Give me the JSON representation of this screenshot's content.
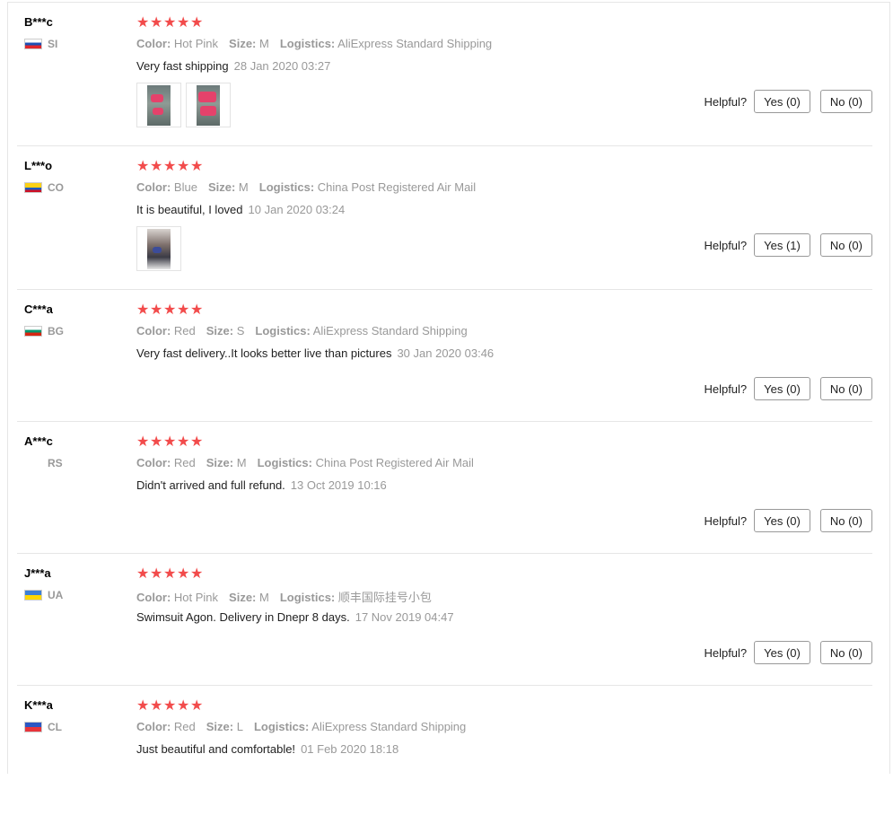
{
  "helpful_label": "Helpful?",
  "colors": {
    "star": "#f24b4b",
    "muted": "#999999",
    "border": "#e6e6e6"
  },
  "reviews": [
    {
      "user": "B***c",
      "country": "SI",
      "flag": "slovenia-flag-icon",
      "rating": 5,
      "attrs": [
        {
          "k": "Color:",
          "v": "Hot Pink"
        },
        {
          "k": "Size:",
          "v": "M"
        },
        {
          "k": "Logistics:",
          "v": "AliExpress Standard Shipping"
        }
      ],
      "text": "Very fast shipping",
      "date": "28 Jan 2020 03:27",
      "photos": 2,
      "yes": "Yes (0)",
      "no": "No (0)"
    },
    {
      "user": "L***o",
      "country": "CO",
      "flag": "colombia-flag-icon",
      "rating": 5,
      "attrs": [
        {
          "k": "Color:",
          "v": "Blue"
        },
        {
          "k": "Size:",
          "v": "M"
        },
        {
          "k": "Logistics:",
          "v": "China Post Registered Air Mail"
        }
      ],
      "text": "It is beautiful, I loved",
      "date": "10 Jan 2020 03:24",
      "photos": 1,
      "yes": "Yes (1)",
      "no": "No (0)"
    },
    {
      "user": "C***a",
      "country": "BG",
      "flag": "bulgaria-flag-icon",
      "rating": 5,
      "attrs": [
        {
          "k": "Color:",
          "v": "Red"
        },
        {
          "k": "Size:",
          "v": "S"
        },
        {
          "k": "Logistics:",
          "v": "AliExpress Standard Shipping"
        }
      ],
      "text": "Very fast delivery..It looks better live than pictures",
      "date": "30 Jan 2020 03:46",
      "photos": 0,
      "yes": "Yes (0)",
      "no": "No (0)"
    },
    {
      "user": "A***c",
      "country": "RS",
      "flag": "",
      "rating": 5,
      "attrs": [
        {
          "k": "Color:",
          "v": "Red"
        },
        {
          "k": "Size:",
          "v": "M"
        },
        {
          "k": "Logistics:",
          "v": "China Post Registered Air Mail"
        }
      ],
      "text": "Didn't arrived and full refund.",
      "date": "13 Oct 2019 10:16",
      "photos": 0,
      "yes": "Yes (0)",
      "no": "No (0)"
    },
    {
      "user": "J***a",
      "country": "UA",
      "flag": "ukraine-flag-icon",
      "rating": 5,
      "attrs": [
        {
          "k": "Color:",
          "v": "Hot Pink"
        },
        {
          "k": "Size:",
          "v": "M"
        },
        {
          "k": "Logistics:",
          "v": "顺丰国际挂号小包"
        }
      ],
      "text": "Swimsuit Agon. Delivery in Dnepr 8 days.",
      "date": "17 Nov 2019 04:47",
      "photos": 0,
      "yes": "Yes (0)",
      "no": "No (0)"
    },
    {
      "user": "K***a",
      "country": "CL",
      "flag": "chile-flag-icon",
      "rating": 5,
      "attrs": [
        {
          "k": "Color:",
          "v": "Red"
        },
        {
          "k": "Size:",
          "v": "L"
        },
        {
          "k": "Logistics:",
          "v": "AliExpress Standard Shipping"
        }
      ],
      "text": "Just beautiful and comfortable!",
      "date": "01 Feb 2020 18:18",
      "photos": 0,
      "yes": "",
      "no": ""
    }
  ]
}
